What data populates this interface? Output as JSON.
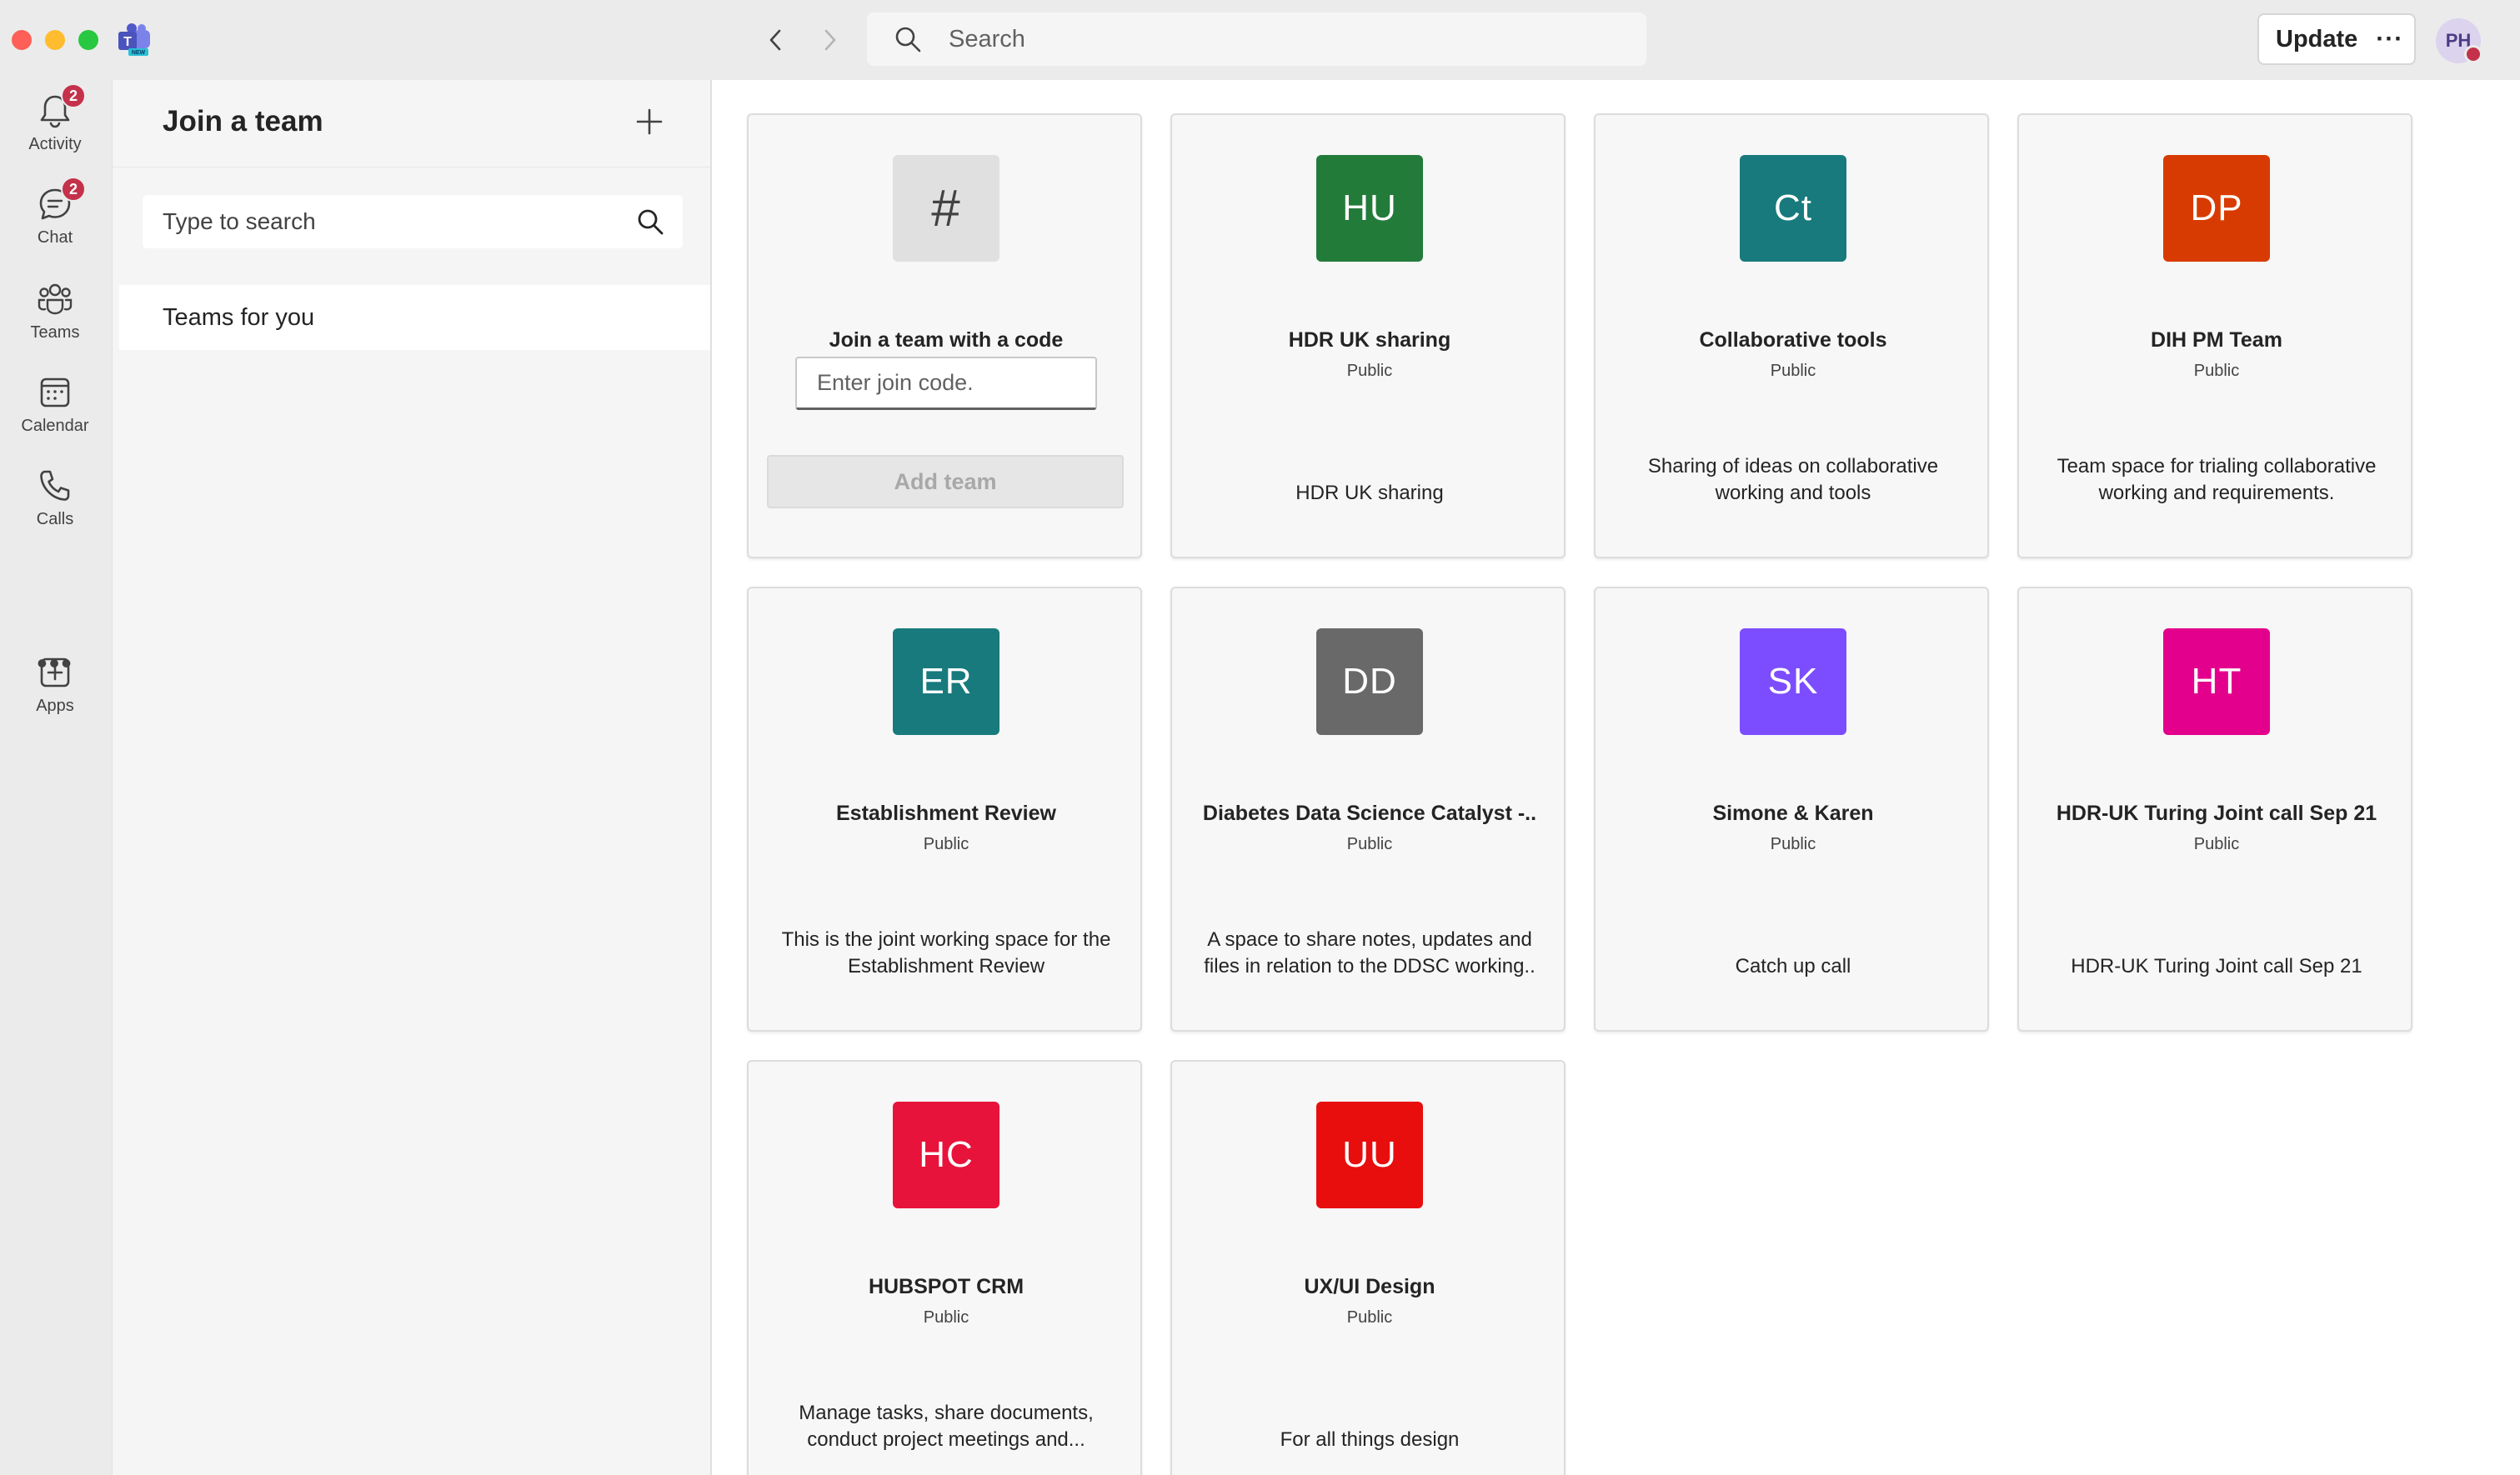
{
  "search": {
    "placeholder": "Search"
  },
  "header": {
    "update_label": "Update",
    "more_label": "···",
    "avatar_initials": "PH"
  },
  "rail": {
    "items": [
      {
        "label": "Activity",
        "badge": "2"
      },
      {
        "label": "Chat",
        "badge": "2"
      },
      {
        "label": "Teams"
      },
      {
        "label": "Calendar"
      },
      {
        "label": "Calls"
      },
      {
        "label": "Apps"
      }
    ],
    "more": "•••"
  },
  "panel": {
    "title": "Join a team",
    "search_placeholder": "Type to search",
    "nav_item": "Teams for you"
  },
  "join_card": {
    "icon": "#",
    "title": "Join a team with a code",
    "input_placeholder": "Enter join code.",
    "button": "Add team"
  },
  "teams": [
    {
      "initials": "HU",
      "name": "HDR UK sharing",
      "visibility": "Public",
      "description": "HDR UK sharing",
      "color": "#237b3a"
    },
    {
      "initials": "Ct",
      "name": "Collaborative tools",
      "visibility": "Public",
      "description": "Sharing of ideas on collaborative working and tools",
      "color": "#187a7d"
    },
    {
      "initials": "DP",
      "name": "DIH PM Team",
      "visibility": "Public",
      "description": "Team space for trialing collaborative working and requirements.",
      "color": "#d83b01"
    },
    {
      "initials": "ER",
      "name": "Establishment Review",
      "visibility": "Public",
      "description": "This is the joint working space for the Establishment Review",
      "color": "#187a7d"
    },
    {
      "initials": "DD",
      "name": "Diabetes Data Science Catalyst -..",
      "visibility": "Public",
      "description": "A space to share notes, updates and files in relation to the DDSC working..",
      "color": "#696969"
    },
    {
      "initials": "SK",
      "name": "Simone & Karen",
      "visibility": "Public",
      "description": "Catch up call",
      "color": "#7c4dff"
    },
    {
      "initials": "HT",
      "name": "HDR-UK Turing Joint call Sep 21",
      "visibility": "Public",
      "description": "HDR-UK Turing Joint call Sep 21",
      "color": "#e3008c"
    },
    {
      "initials": "HC",
      "name": "HUBSPOT CRM",
      "visibility": "Public",
      "description": "Manage tasks, share documents, conduct project meetings and...",
      "color": "#e8133a"
    },
    {
      "initials": "UU",
      "name": "UX/UI Design",
      "visibility": "Public",
      "description": "For all things design",
      "color": "#e80e0e"
    }
  ]
}
